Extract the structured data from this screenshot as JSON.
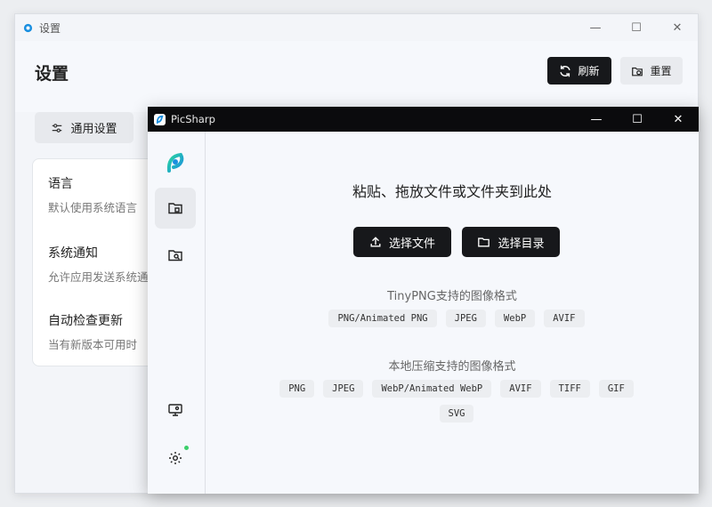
{
  "back_window": {
    "title": "设置",
    "page_title": "设置",
    "refresh_label": "刷新",
    "reset_label": "重置",
    "tab_general": "通用设置",
    "settings": [
      {
        "title": "语言",
        "desc": "默认使用系统语言"
      },
      {
        "title": "系统通知",
        "desc": "允许应用发送系统通知"
      },
      {
        "title": "自动检查更新",
        "desc": "当有新版本可用时"
      }
    ]
  },
  "front_window": {
    "title": "PicSharp",
    "headline": "粘贴、拖放文件或文件夹到此处",
    "select_file_label": "选择文件",
    "select_dir_label": "选择目录",
    "tinypng_title": "TinyPNG支持的图像格式",
    "tinypng_formats": [
      "PNG/Animated PNG",
      "JPEG",
      "WebP",
      "AVIF"
    ],
    "local_title": "本地压缩支持的图像格式",
    "local_formats": [
      "PNG",
      "JPEG",
      "WebP/Animated WebP",
      "AVIF",
      "TIFF",
      "GIF",
      "SVG"
    ]
  },
  "colors": {
    "accent_dark": "#17181b",
    "status_dot": "#3ccf6b",
    "logo_blue": "#1a8fe0",
    "logo_green": "#2ad6a0"
  },
  "icons": [
    "app-logo-icon",
    "refresh-icon",
    "reset-icon",
    "sliders-icon",
    "compress-icon",
    "search-folder-icon",
    "monitor-icon",
    "gear-icon",
    "upload-icon",
    "folder-icon"
  ]
}
